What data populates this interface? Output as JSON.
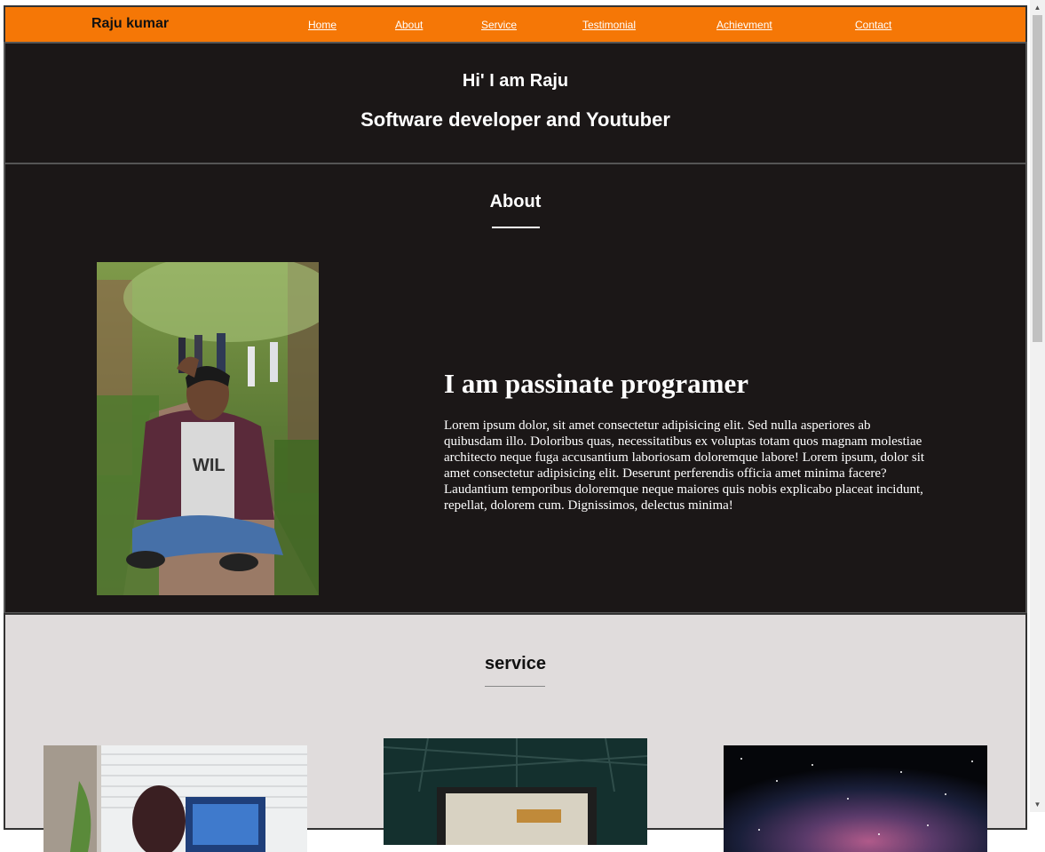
{
  "nav": {
    "brand": "Raju kumar",
    "links": [
      "Home",
      "About",
      "Service",
      "Testimonial",
      "Achievment",
      "Contact"
    ]
  },
  "hero": {
    "greeting": "Hi' I am Raju",
    "role": "Software developer and Youtuber"
  },
  "about": {
    "title": "About",
    "headline": "I am passinate programer",
    "body": "Lorem ipsum dolor, sit amet consectetur adipisicing elit. Sed nulla asperiores ab quibusdam illo. Doloribus quas, necessitatibus ex voluptas totam quos magnam molestiae architecto neque fuga accusantium laboriosam doloremque labore! Lorem ipsum, dolor sit amet consectetur adipisicing elit. Deserunt perferendis officia amet minima facere? Laudantium temporibus doloremque neque maiores quis nobis explicabo placeat incidunt, repellat, dolorem cum. Dignissimos, delectus minima!"
  },
  "service": {
    "title": "service"
  },
  "colors": {
    "nav_bg": "#f57706",
    "dark_bg": "#1b1717",
    "service_bg": "#e0dcdc"
  }
}
